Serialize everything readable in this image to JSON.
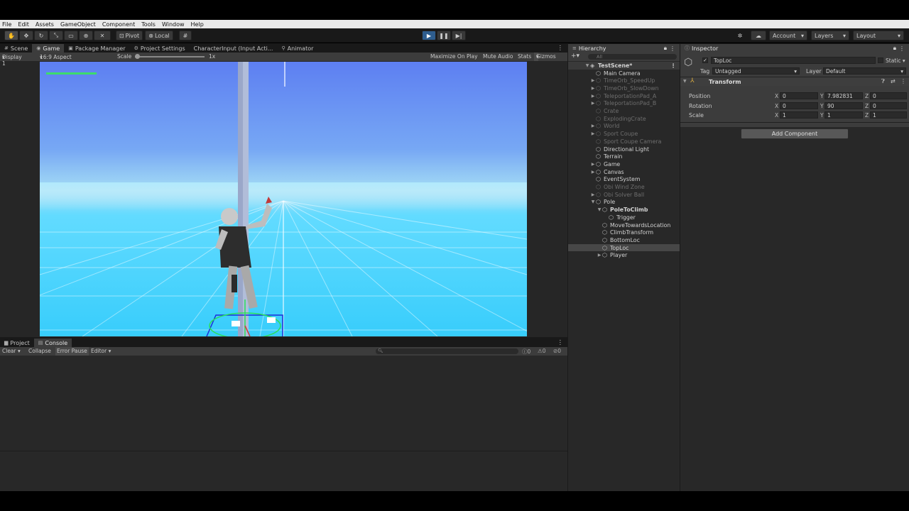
{
  "menu": [
    "File",
    "Edit",
    "Assets",
    "GameObject",
    "Component",
    "Tools",
    "Window",
    "Help"
  ],
  "toolbar": {
    "pivot_label": "Pivot",
    "local_label": "Local",
    "account_label": "Account",
    "layers_label": "Layers",
    "layout_label": "Layout"
  },
  "left_tabs": {
    "scene": "Scene",
    "game": "Game",
    "package_manager": "Package Manager",
    "project_settings": "Project Settings",
    "character_input": "CharacterInput (Input Acti...",
    "animator": "Animator"
  },
  "gamebar": {
    "display": "Display 1",
    "aspect": "16:9 Aspect",
    "scale_label": "Scale",
    "scale_value": "1x",
    "maximize": "Maximize On Play",
    "mute": "Mute Audio",
    "stats": "Stats",
    "gizmos": "Gizmos"
  },
  "bottom_tabs": {
    "project": "Project",
    "console": "Console"
  },
  "console": {
    "clear": "Clear",
    "collapse": "Collapse",
    "error_pause": "Error Pause",
    "editor": "Editor",
    "count_info": "0",
    "count_warn": "0",
    "count_error": "0"
  },
  "hierarchy": {
    "title": "Hierarchy",
    "search_placeholder": "All",
    "scene_name": "TestScene*",
    "items": [
      {
        "label": "Main Camera"
      },
      {
        "label": "TimeOrb_SpeedUp"
      },
      {
        "label": "TimeOrb_SlowDown"
      },
      {
        "label": "TeleportationPad_A"
      },
      {
        "label": "TeleportationPad_B"
      },
      {
        "label": "Crate"
      },
      {
        "label": "ExplodingCrate"
      },
      {
        "label": "World"
      },
      {
        "label": "Sport Coupe"
      },
      {
        "label": "Sport Coupe Camera"
      },
      {
        "label": "Directional Light"
      },
      {
        "label": "Terrain"
      },
      {
        "label": "Game"
      },
      {
        "label": "Canvas"
      },
      {
        "label": "EventSystem"
      },
      {
        "label": "Obi Wind Zone"
      },
      {
        "label": "Obi Solver Ball"
      },
      {
        "label": "Pole"
      },
      {
        "label": "PoleToClimb"
      },
      {
        "label": "Trigger"
      },
      {
        "label": "MoveTowardsLocation"
      },
      {
        "label": "ClimbTransform"
      },
      {
        "label": "BottomLoc"
      },
      {
        "label": "TopLoc"
      },
      {
        "label": "Player"
      }
    ]
  },
  "inspector": {
    "title": "Inspector",
    "object_name": "TopLoc",
    "static_label": "Static",
    "tag_label": "Tag",
    "tag_value": "Untagged",
    "layer_label": "Layer",
    "layer_value": "Default",
    "component_title": "Transform",
    "position_label": "Position",
    "rotation_label": "Rotation",
    "scale_label": "Scale",
    "axis_x": "X",
    "axis_y": "Y",
    "axis_z": "Z",
    "position": {
      "x": "0",
      "y": "7.982831",
      "z": "0"
    },
    "rotation": {
      "x": "0",
      "y": "90",
      "z": "0"
    },
    "scale": {
      "x": "1",
      "y": "1",
      "z": "1"
    },
    "add_component": "Add Component"
  },
  "colors": {
    "play_active": "#2e5d8e",
    "selection": "#474747",
    "health_bar": "#3ddc6b"
  }
}
